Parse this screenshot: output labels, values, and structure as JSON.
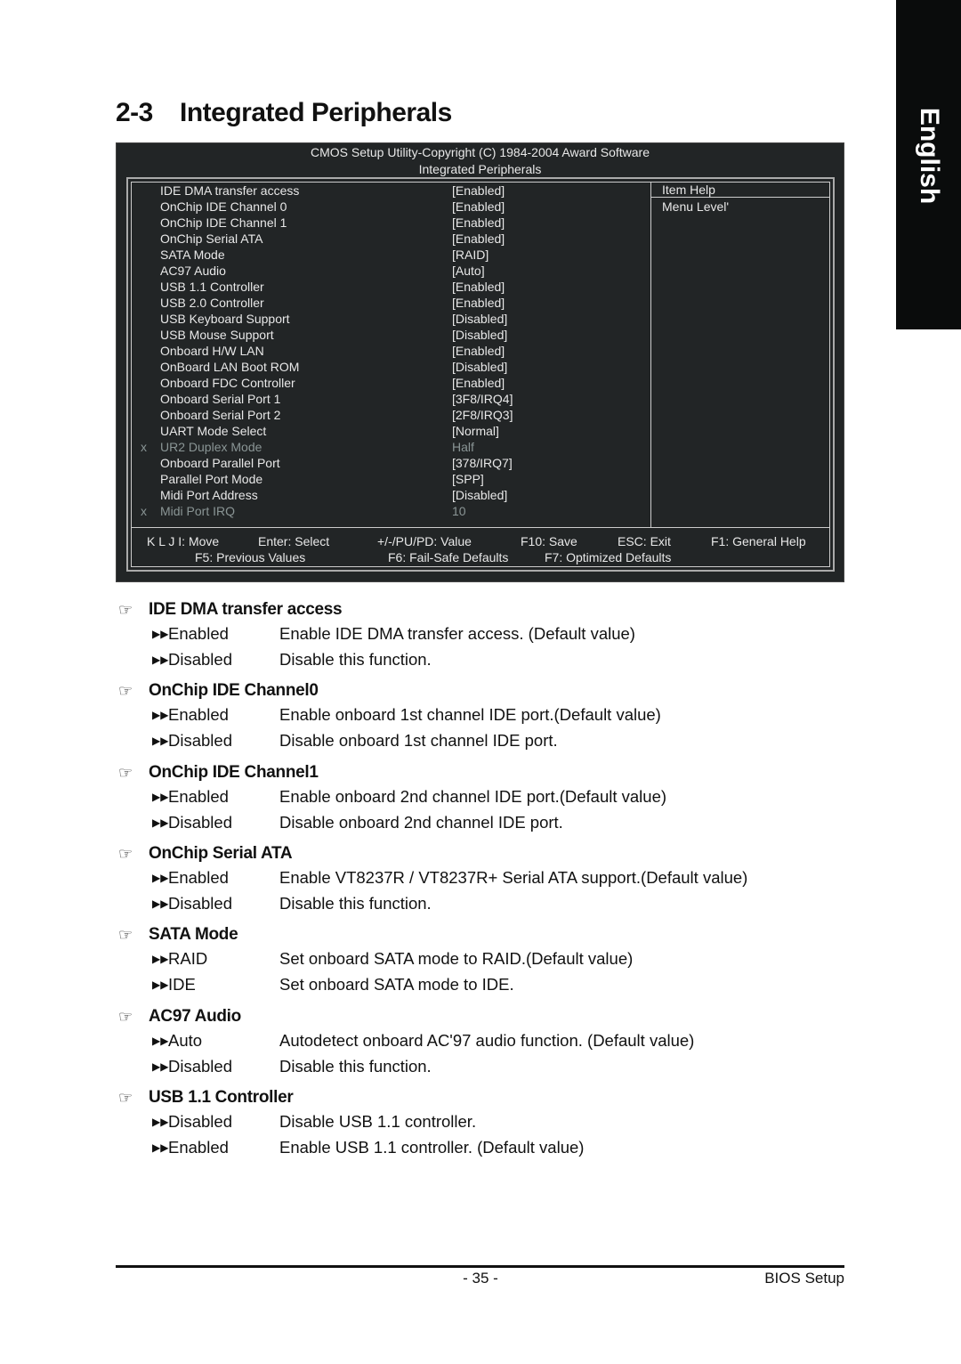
{
  "language_tab": "English",
  "page_title": {
    "number": "2-3",
    "text": "Integrated Peripherals"
  },
  "bios": {
    "header_line1": "CMOS Setup Utility-Copyright (C) 1984-2004 Award Software",
    "header_line2": "Integrated Peripherals",
    "items": [
      {
        "marker": "",
        "label": "IDE DMA transfer access",
        "value": "[Enabled]",
        "disabled": false
      },
      {
        "marker": "",
        "label": "OnChip IDE Channel 0",
        "value": "[Enabled]",
        "disabled": false
      },
      {
        "marker": "",
        "label": "OnChip IDE Channel 1",
        "value": "[Enabled]",
        "disabled": false
      },
      {
        "marker": "",
        "label": "OnChip Serial ATA",
        "value": "[Enabled]",
        "disabled": false
      },
      {
        "marker": "",
        "label": "SATA Mode",
        "value": "[RAID]",
        "disabled": false
      },
      {
        "marker": "",
        "label": "AC97 Audio",
        "value": "[Auto]",
        "disabled": false
      },
      {
        "marker": "",
        "label": "USB 1.1 Controller",
        "value": "[Enabled]",
        "disabled": false
      },
      {
        "marker": "",
        "label": "USB 2.0 Controller",
        "value": "[Enabled]",
        "disabled": false
      },
      {
        "marker": "",
        "label": "USB Keyboard Support",
        "value": "[Disabled]",
        "disabled": false
      },
      {
        "marker": "",
        "label": "USB Mouse Support",
        "value": "[Disabled]",
        "disabled": false
      },
      {
        "marker": "",
        "label": "Onboard H/W LAN",
        "value": "[Enabled]",
        "disabled": false
      },
      {
        "marker": "",
        "label": "OnBoard LAN Boot ROM",
        "value": "[Disabled]",
        "disabled": false
      },
      {
        "marker": "",
        "label": "Onboard FDC Controller",
        "value": "[Enabled]",
        "disabled": false
      },
      {
        "marker": "",
        "label": "Onboard Serial Port 1",
        "value": "[3F8/IRQ4]",
        "disabled": false
      },
      {
        "marker": "",
        "label": "Onboard Serial Port 2",
        "value": "[2F8/IRQ3]",
        "disabled": false
      },
      {
        "marker": "",
        "label": "UART Mode Select",
        "value": "[Normal]",
        "disabled": false
      },
      {
        "marker": "x",
        "label": "UR2 Duplex Mode",
        "value": "Half",
        "disabled": true
      },
      {
        "marker": "",
        "label": "Onboard Parallel Port",
        "value": "[378/IRQ7]",
        "disabled": false
      },
      {
        "marker": "",
        "label": "Parallel Port Mode",
        "value": "[SPP]",
        "disabled": false
      },
      {
        "marker": "",
        "label": "Midi Port Address",
        "value": "[Disabled]",
        "disabled": false
      },
      {
        "marker": "x",
        "label": "Midi Port IRQ",
        "value": "10",
        "disabled": true
      }
    ],
    "help_title": "Item Help",
    "help_text": "Menu Level'",
    "keys_row1": [
      "K L J I: Move",
      "Enter: Select",
      "+/-/PU/PD: Value",
      "F10: Save",
      "ESC: Exit",
      "F1: General Help"
    ],
    "keys_row2": [
      "F5: Previous Values",
      "F6: Fail-Safe Defaults",
      "F7: Optimized Defaults"
    ]
  },
  "sections": [
    {
      "title": "IDE DMA transfer access",
      "options": [
        {
          "name": "Enabled",
          "desc": "Enable IDE DMA transfer access. (Default value)"
        },
        {
          "name": "Disabled",
          "desc": "Disable this function."
        }
      ]
    },
    {
      "title": "OnChip IDE Channel0",
      "options": [
        {
          "name": "Enabled",
          "desc": "Enable onboard 1st channel IDE port.(Default value)"
        },
        {
          "name": "Disabled",
          "desc": "Disable onboard 1st channel IDE port."
        }
      ]
    },
    {
      "title": "OnChip IDE Channel1",
      "options": [
        {
          "name": "Enabled",
          "desc": "Enable onboard 2nd channel IDE port.(Default value)"
        },
        {
          "name": "Disabled",
          "desc": "Disable onboard 2nd channel IDE port."
        }
      ]
    },
    {
      "title": "OnChip Serial ATA",
      "options": [
        {
          "name": "Enabled",
          "desc": "Enable VT8237R / VT8237R+ Serial ATA support.(Default value)"
        },
        {
          "name": "Disabled",
          "desc": "Disable this function."
        }
      ]
    },
    {
      "title": "SATA Mode",
      "options": [
        {
          "name": "RAID",
          "desc": "Set onboard SATA mode to RAID.(Default value)"
        },
        {
          "name": "IDE",
          "desc": "Set onboard SATA mode to IDE."
        }
      ]
    },
    {
      "title": "AC97 Audio",
      "options": [
        {
          "name": "Auto",
          "desc": "Autodetect onboard AC'97 audio function. (Default value)"
        },
        {
          "name": "Disabled",
          "desc": "Disable this function."
        }
      ]
    },
    {
      "title": "USB 1.1 Controller",
      "options": [
        {
          "name": "Disabled",
          "desc": "Disable USB 1.1 controller."
        },
        {
          "name": "Enabled",
          "desc": "Enable USB 1.1 controller. (Default value)"
        }
      ]
    }
  ],
  "icons": {
    "section_bullet": "pointing-hand-icon",
    "option_bullet": "double-arrow-right-icon"
  },
  "footer": {
    "page_number": "- 35 -",
    "right_text": "BIOS Setup"
  }
}
